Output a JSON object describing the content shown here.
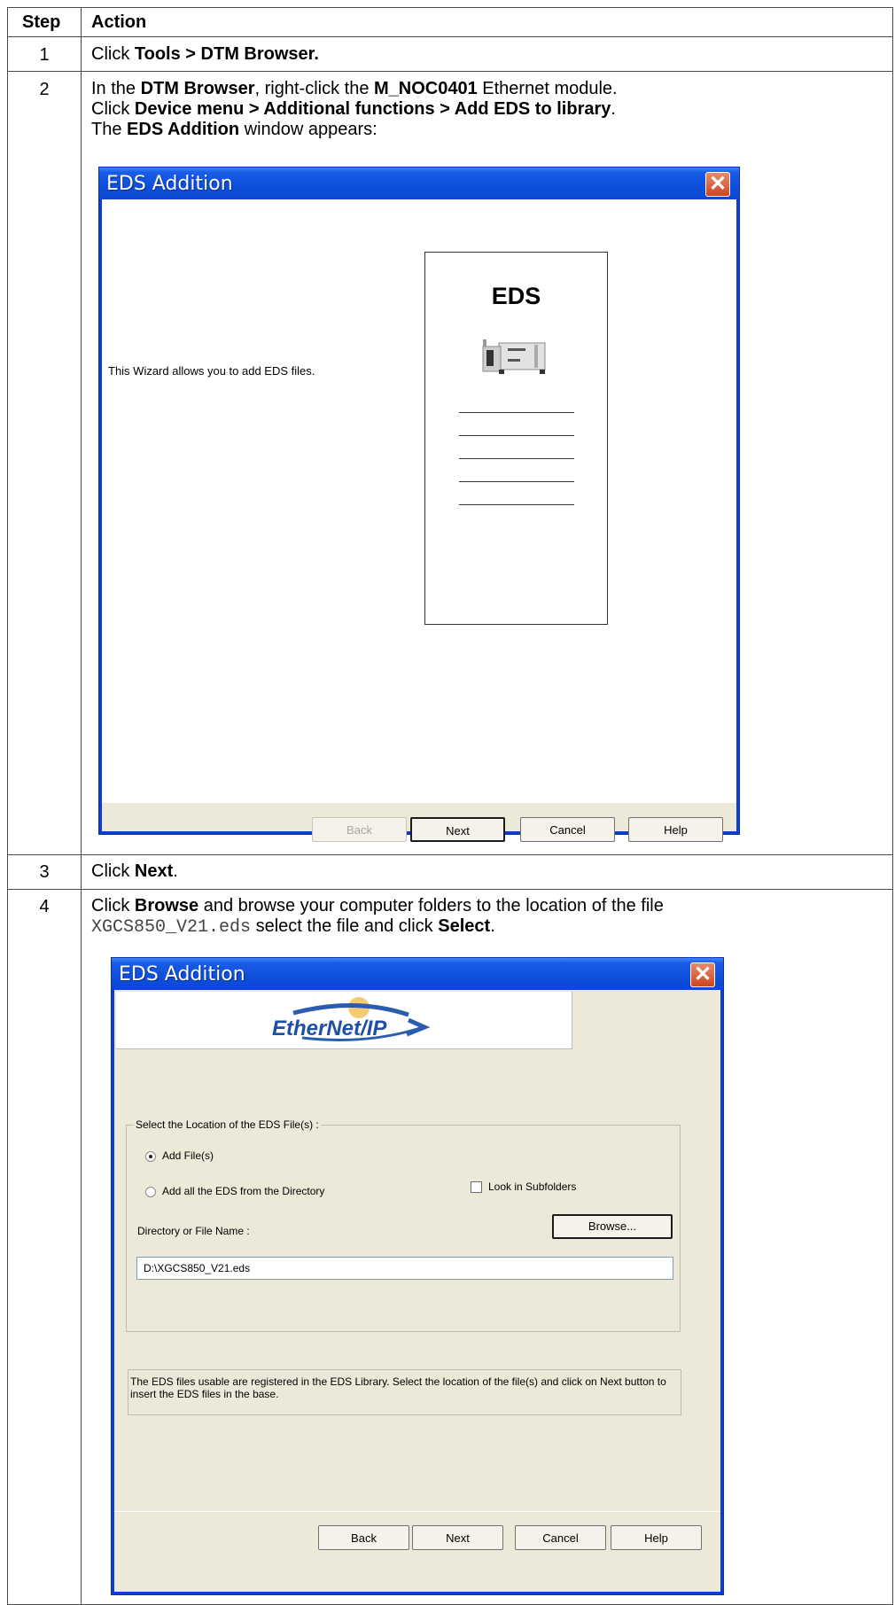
{
  "table": {
    "headers": {
      "step": "Step",
      "action": "Action"
    },
    "rows": [
      {
        "step": "1",
        "lines": [
          {
            "pre": "Click ",
            "b1": "Tools > DTM Browser.",
            "post": ""
          }
        ]
      },
      {
        "step": "2",
        "lines": [
          {
            "pre": "In the ",
            "b1": "DTM Browser",
            "mid": ", right-click the ",
            "b2": "M_NOC0401",
            "post": " Ethernet module."
          },
          {
            "pre": "Click ",
            "b1": "Device menu > Additional functions >  Add EDS to library",
            "post": "."
          },
          {
            "pre": "The ",
            "b1": "EDS Addition",
            "post": " window appears:"
          }
        ]
      },
      {
        "step": "3",
        "lines": [
          {
            "pre": "Click ",
            "b1": "Next",
            "post": "."
          }
        ]
      },
      {
        "step": "4",
        "lines": [
          {
            "pre": "Click ",
            "b1": "Browse",
            "post": " and browse your computer folders to the location of the file"
          },
          {
            "code": "XGCS850_V21.eds",
            "pre": " select the file and click ",
            "b1": "Select",
            "post": "."
          }
        ]
      }
    ]
  },
  "dialog1": {
    "title": "EDS Addition",
    "intro": "This Wizard allows you to add EDS files.",
    "card_label": "EDS",
    "buttons": {
      "back": "Back",
      "next": "Next",
      "cancel": "Cancel",
      "help": "Help"
    }
  },
  "dialog2": {
    "title": "EDS Addition",
    "logo": "EtherNet/IP",
    "group_label": "Select the Location of the EDS File(s) :",
    "radio_add_files": "Add File(s)",
    "radio_add_dir": "Add all the EDS from the Directory",
    "check_subfolders": "Look in Subfolders",
    "dir_label": "Directory or File Name :",
    "browse": "Browse...",
    "path_value": "D:\\XGCS850_V21.eds",
    "info_text": "The EDS files usable are registered in the EDS Library. Select the location of the file(s) and click on Next button to insert the EDS files in the base.",
    "buttons": {
      "back": "Back",
      "next": "Next",
      "cancel": "Cancel",
      "help": "Help"
    }
  },
  "colors": {
    "titlebar": "#0a48cf",
    "dialog_bg": "#ece9d8",
    "close": "#d0451f"
  }
}
